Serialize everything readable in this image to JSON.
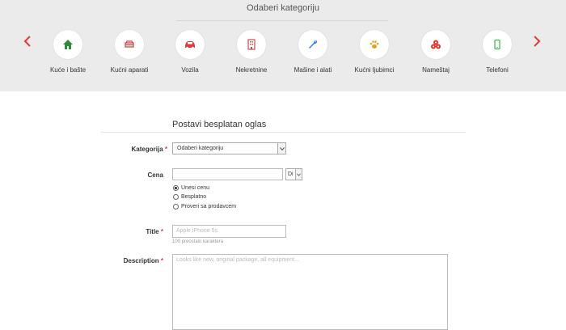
{
  "categories": {
    "title": "Odaberi kategoriju",
    "items": [
      {
        "label": "Kuće i bašte",
        "icon": "house-icon",
        "color": "#2e8b3a"
      },
      {
        "label": "Kućni aparati",
        "icon": "appliance-icon",
        "color": "#e03a3a"
      },
      {
        "label": "Vozila",
        "icon": "car-icon",
        "color": "#e03a3a"
      },
      {
        "label": "Nekretnine",
        "icon": "building-icon",
        "color": "#c0504d"
      },
      {
        "label": "Mašine i alati",
        "icon": "wrench-icon",
        "color": "#2c7fd6"
      },
      {
        "label": "Kućni ljubimci",
        "icon": "paw-icon",
        "color": "#e5a11c"
      },
      {
        "label": "Nameštaj",
        "icon": "furniture-icon",
        "color": "#d9372f"
      },
      {
        "label": "Telefoni",
        "icon": "phone-icon",
        "color": "#3cb44b"
      }
    ]
  },
  "form": {
    "title": "Postavi besplatan oglas",
    "category": {
      "label": "Kategorija",
      "required_mark": "*",
      "value": "Odaberi kategoriju"
    },
    "price": {
      "label": "Cena",
      "value": "",
      "currency": "Di",
      "options": [
        {
          "label": "Unesi cenu",
          "selected": true
        },
        {
          "label": "Besplatno",
          "selected": false
        },
        {
          "label": "Proveri sa prodavcem",
          "selected": false
        }
      ]
    },
    "title_field": {
      "label": "Title",
      "required_mark": "*",
      "placeholder": "Apple iPhone 5s",
      "hint": "100 preostalo karaktera"
    },
    "description": {
      "label": "Description",
      "required_mark": "*",
      "placeholder": "Looks like new, original package, all equipment..."
    }
  },
  "colors": {
    "accent": "#e03a3a",
    "band": "#ebebeb"
  }
}
